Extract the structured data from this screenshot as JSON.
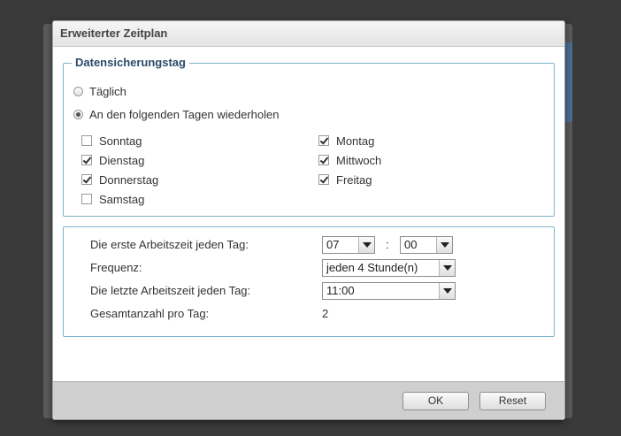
{
  "dialog": {
    "title": "Erweiterter Zeitplan"
  },
  "backup_day": {
    "legend": "Datensicherungstag",
    "radio_daily": "Täglich",
    "radio_repeat": "An den folgenden Tagen wiederholen",
    "days": [
      {
        "label": "Sonntag",
        "checked": false
      },
      {
        "label": "Montag",
        "checked": true
      },
      {
        "label": "Dienstag",
        "checked": true
      },
      {
        "label": "Mittwoch",
        "checked": true
      },
      {
        "label": "Donnerstag",
        "checked": true
      },
      {
        "label": "Freitag",
        "checked": true
      },
      {
        "label": "Samstag",
        "checked": false
      }
    ]
  },
  "schedule": {
    "first_time_label": "Die erste Arbeitszeit jeden Tag:",
    "first_hour": "07",
    "time_separator": ":",
    "first_minute": "00",
    "frequency_label": "Frequenz:",
    "frequency_value": "jeden 4 Stunde(n)",
    "last_time_label": "Die letzte Arbeitszeit jeden Tag:",
    "last_time_value": "11:00",
    "total_label": "Gesamtanzahl pro Tag:",
    "total_value": "2"
  },
  "footer": {
    "ok_label": "OK",
    "reset_label": "Reset"
  }
}
